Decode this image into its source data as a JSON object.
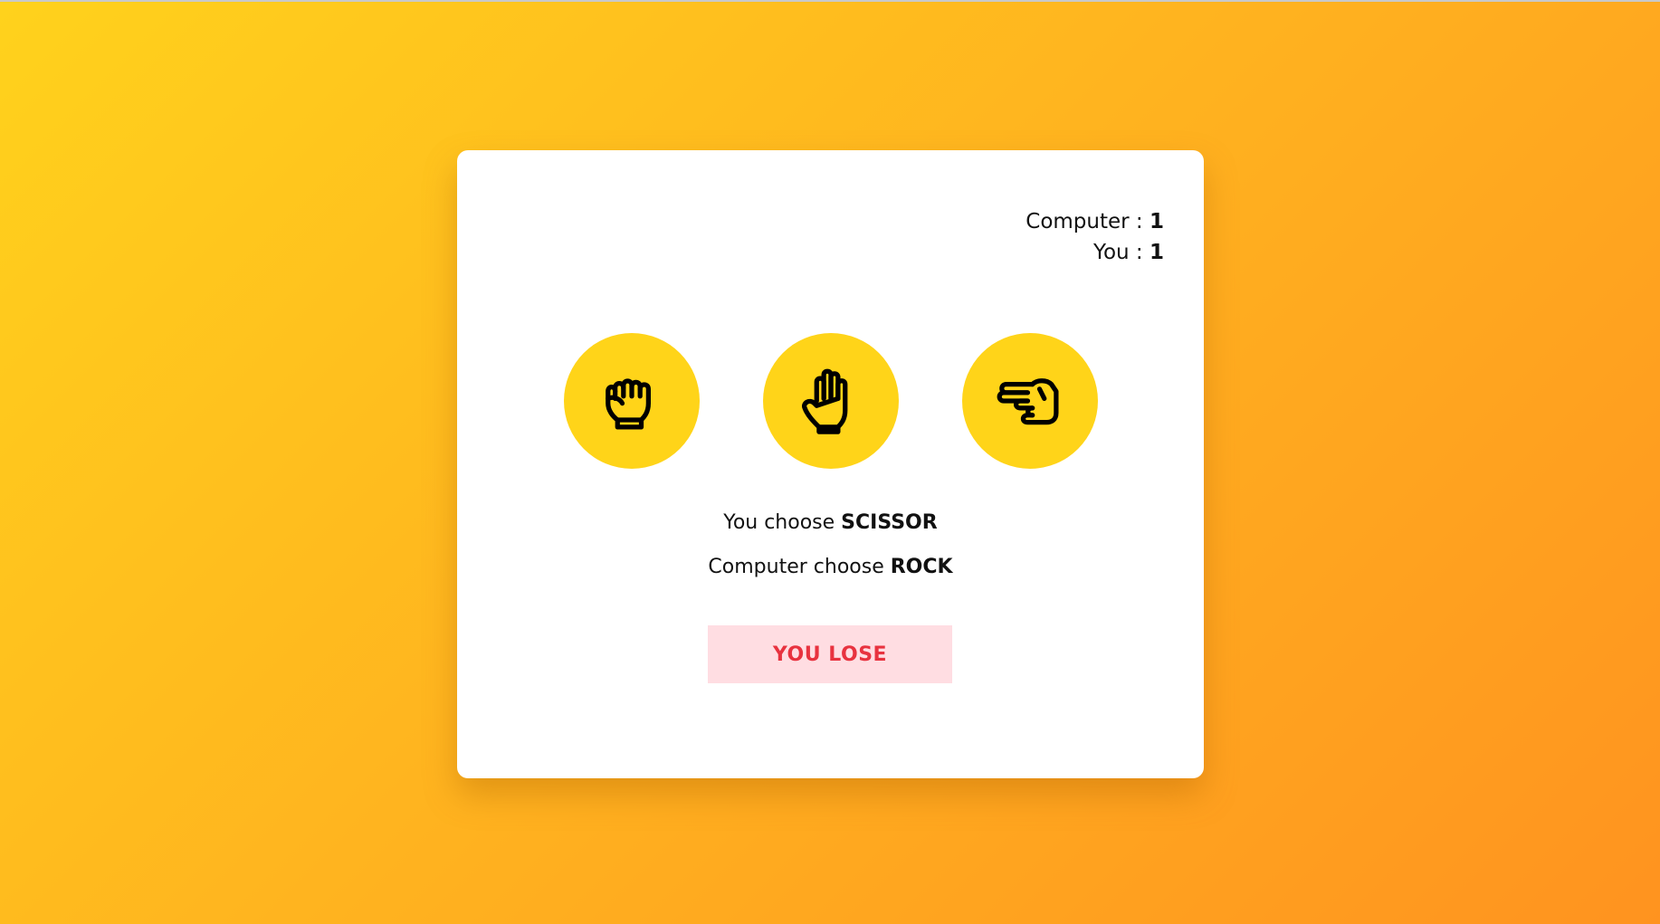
{
  "score": {
    "computer_label": "Computer : ",
    "computer_value": "1",
    "you_label": "You : ",
    "you_value": "1"
  },
  "choices": [
    {
      "name": "rock",
      "icon": "rock-hand-icon"
    },
    {
      "name": "paper",
      "icon": "paper-hand-icon"
    },
    {
      "name": "scissor",
      "icon": "scissor-hand-icon"
    }
  ],
  "result": {
    "user_prefix": "You choose ",
    "user_choice": "SCISSOR",
    "computer_prefix": "Computer choose ",
    "computer_choice": "ROCK",
    "outcome": "YOU LOSE"
  },
  "colors": {
    "background_start": "#ffd21c",
    "background_end": "#ff931f",
    "choice_circle": "#ffd419",
    "outcome_bg": "#ffdde2",
    "outcome_text": "#e8323f"
  }
}
